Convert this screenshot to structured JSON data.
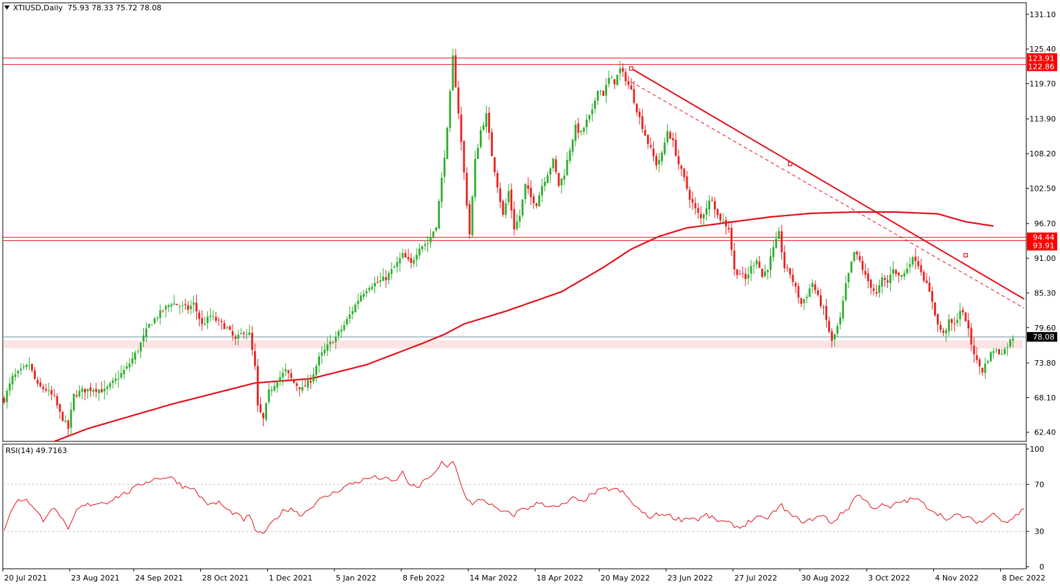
{
  "header": {
    "symbol": "XTIUSD,Daily",
    "ohlc": "75.93 78.33 75.72 78.08"
  },
  "rsi_header": {
    "label": "RSI(14) 49.7163"
  },
  "price_axis": {
    "ticks": [
      "131.10",
      "125.40",
      "119.70",
      "113.90",
      "108.20",
      "102.50",
      "96.70",
      "91.00",
      "85.30",
      "79.60",
      "73.80",
      "68.10",
      "62.40"
    ],
    "tick_values": [
      131.1,
      125.4,
      119.7,
      113.9,
      108.2,
      102.5,
      96.7,
      91.0,
      85.3,
      79.6,
      73.8,
      68.1,
      62.4
    ]
  },
  "rsi_axis": {
    "ticks": [
      "100",
      "70",
      "30",
      "0"
    ],
    "tick_values": [
      100,
      70,
      30,
      0
    ]
  },
  "price_labels": [
    {
      "text": "123.91",
      "value": 123.91,
      "bg": "#ff0000",
      "color": "#ffffff"
    },
    {
      "text": "122.86",
      "value": 122.86,
      "bg": "#ff0000",
      "color": "#ffffff"
    },
    {
      "text": "94.44",
      "value": 94.44,
      "bg": "#ff0000",
      "color": "#ffffff"
    },
    {
      "text": "93.91",
      "value": 93.91,
      "bg": "#ff0000",
      "color": "#ffffff"
    },
    {
      "text": "78.08",
      "value": 78.08,
      "bg": "#000000",
      "color": "#ffffff"
    }
  ],
  "time_axis": {
    "labels": [
      "20 Jul 2021",
      "23 Aug 2021",
      "24 Sep 2021",
      "28 Oct 2021",
      "1 Dec 2021",
      "5 Jan 2022",
      "8 Feb 2022",
      "14 Mar 2022",
      "18 Apr 2022",
      "20 May 2022",
      "23 Jun 2022",
      "27 Jul 2022",
      "30 Aug 2022",
      "3 Oct 2022",
      "4 Nov 2022",
      "8 Dec 2022"
    ],
    "bar_index": [
      0,
      24,
      47,
      71,
      95,
      119,
      143,
      167,
      191,
      214,
      238,
      262,
      286,
      310,
      334,
      358
    ]
  },
  "colors": {
    "bull": "#2eae2e",
    "bear": "#e8201e",
    "line": "#e2101a",
    "zone": "#fde4e4",
    "grid": "#c8c8c8",
    "axis": "#000000"
  },
  "chart_data": {
    "type": "candlestick",
    "symbol": "XTIUSD",
    "timeframe": "Daily",
    "ylim": [
      60.9,
      133.0
    ],
    "bars_visible": 367,
    "anchors": [
      [
        0,
        67.8
      ],
      [
        3,
        71.4
      ],
      [
        7,
        72.8
      ],
      [
        9,
        73.5
      ],
      [
        12,
        70.0
      ],
      [
        15,
        69.4
      ],
      [
        18,
        68.0
      ],
      [
        20,
        65.5
      ],
      [
        23,
        63.0
      ],
      [
        25,
        68.5
      ],
      [
        28,
        69.2
      ],
      [
        32,
        69.6
      ],
      [
        36,
        69.2
      ],
      [
        40,
        71.0
      ],
      [
        44,
        73.0
      ],
      [
        48,
        76.0
      ],
      [
        52,
        80.0
      ],
      [
        56,
        82.0
      ],
      [
        60,
        83.7
      ],
      [
        63,
        83.2
      ],
      [
        66,
        82.7
      ],
      [
        68,
        83.5
      ],
      [
        71,
        80.0
      ],
      [
        74,
        81.5
      ],
      [
        77,
        80.5
      ],
      [
        80,
        79.5
      ],
      [
        83,
        77.5
      ],
      [
        86,
        79.0
      ],
      [
        88,
        78.5
      ],
      [
        90,
        73.0
      ],
      [
        91,
        66.5
      ],
      [
        93,
        64.5
      ],
      [
        95,
        69.0
      ],
      [
        98,
        71.0
      ],
      [
        101,
        72.5
      ],
      [
        104,
        70.5
      ],
      [
        107,
        69.5
      ],
      [
        110,
        71.0
      ],
      [
        113,
        74.5
      ],
      [
        116,
        76.5
      ],
      [
        119,
        78.0
      ],
      [
        122,
        80.0
      ],
      [
        125,
        82.5
      ],
      [
        128,
        85.0
      ],
      [
        131,
        86.5
      ],
      [
        134,
        87.0
      ],
      [
        137,
        87.8
      ],
      [
        140,
        89.5
      ],
      [
        143,
        91.5
      ],
      [
        146,
        90.0
      ],
      [
        149,
        93.0
      ],
      [
        152,
        93.5
      ],
      [
        155,
        96.5
      ],
      [
        157,
        104.0
      ],
      [
        159,
        112.0
      ],
      [
        161,
        124.0
      ],
      [
        163,
        115.0
      ],
      [
        165,
        105.0
      ],
      [
        167,
        95.0
      ],
      [
        169,
        107.0
      ],
      [
        171,
        112.0
      ],
      [
        173,
        114.5
      ],
      [
        175,
        108.0
      ],
      [
        177,
        103.0
      ],
      [
        179,
        98.0
      ],
      [
        181,
        102.0
      ],
      [
        183,
        96.0
      ],
      [
        185,
        98.0
      ],
      [
        187,
        103.0
      ],
      [
        189,
        101.0
      ],
      [
        191,
        100.0
      ],
      [
        193,
        103.0
      ],
      [
        195,
        105.0
      ],
      [
        197,
        107.0
      ],
      [
        199,
        103.0
      ],
      [
        201,
        105.0
      ],
      [
        203,
        109.0
      ],
      [
        205,
        112.5
      ],
      [
        207,
        111.5
      ],
      [
        209,
        113.5
      ],
      [
        211,
        115.0
      ],
      [
        213,
        119.0
      ],
      [
        215,
        118.0
      ],
      [
        217,
        120.5
      ],
      [
        219,
        120.0
      ],
      [
        221,
        122.0
      ],
      [
        223,
        120.5
      ],
      [
        225,
        118.5
      ],
      [
        228,
        114.0
      ],
      [
        231,
        110.0
      ],
      [
        234,
        106.5
      ],
      [
        236,
        108.0
      ],
      [
        238,
        112.0
      ],
      [
        240,
        110.0
      ],
      [
        242,
        106.5
      ],
      [
        244,
        104.0
      ],
      [
        246,
        101.0
      ],
      [
        248,
        99.0
      ],
      [
        250,
        97.5
      ],
      [
        252,
        99.5
      ],
      [
        254,
        101.0
      ],
      [
        256,
        98.0
      ],
      [
        258,
        97.0
      ],
      [
        260,
        96.0
      ],
      [
        262,
        89.0
      ],
      [
        264,
        88.5
      ],
      [
        266,
        87.5
      ],
      [
        268,
        89.5
      ],
      [
        270,
        91.0
      ],
      [
        272,
        88.0
      ],
      [
        274,
        89.5
      ],
      [
        276,
        92.5
      ],
      [
        278,
        95.0
      ],
      [
        280,
        89.5
      ],
      [
        282,
        88.5
      ],
      [
        284,
        86.0
      ],
      [
        286,
        83.5
      ],
      [
        288,
        85.0
      ],
      [
        290,
        87.0
      ],
      [
        292,
        84.5
      ],
      [
        294,
        82.5
      ],
      [
        296,
        79.0
      ],
      [
        297,
        77.2
      ],
      [
        300,
        81.0
      ],
      [
        302,
        86.5
      ],
      [
        305,
        92.0
      ],
      [
        307,
        90.5
      ],
      [
        309,
        88.0
      ],
      [
        311,
        86.5
      ],
      [
        313,
        85.0
      ],
      [
        315,
        87.5
      ],
      [
        317,
        87.0
      ],
      [
        319,
        89.5
      ],
      [
        321,
        88.0
      ],
      [
        323,
        88.5
      ],
      [
        325,
        90.5
      ],
      [
        327,
        91.0
      ],
      [
        329,
        89.0
      ],
      [
        331,
        86.5
      ],
      [
        333,
        84.0
      ],
      [
        335,
        80.0
      ],
      [
        337,
        78.5
      ],
      [
        339,
        80.5
      ],
      [
        341,
        80.0
      ],
      [
        343,
        82.5
      ],
      [
        345,
        81.0
      ],
      [
        347,
        77.0
      ],
      [
        349,
        74.0
      ],
      [
        351,
        72.5
      ],
      [
        353,
        74.5
      ],
      [
        355,
        76.0
      ],
      [
        357,
        75.5
      ],
      [
        359,
        76.0
      ],
      [
        362,
        78.08
      ]
    ],
    "ma200": [
      [
        18,
        60.9
      ],
      [
        30,
        63.0
      ],
      [
        60,
        67.0
      ],
      [
        90,
        70.5
      ],
      [
        110,
        71.2
      ],
      [
        130,
        73.5
      ],
      [
        150,
        77.0
      ],
      [
        158,
        78.5
      ],
      [
        165,
        80.2
      ],
      [
        180,
        82.3
      ],
      [
        200,
        85.5
      ],
      [
        215,
        89.5
      ],
      [
        225,
        92.5
      ],
      [
        235,
        94.6
      ],
      [
        245,
        96.0
      ],
      [
        260,
        96.9
      ],
      [
        275,
        97.8
      ],
      [
        290,
        98.4
      ],
      [
        305,
        98.6
      ],
      [
        320,
        98.6
      ],
      [
        335,
        98.3
      ],
      [
        345,
        97.0
      ],
      [
        355,
        96.3
      ]
    ],
    "rsi": {
      "period": 14,
      "last": 49.7163,
      "anchors": [
        [
          0,
          32
        ],
        [
          4,
          55
        ],
        [
          8,
          58
        ],
        [
          11,
          48
        ],
        [
          14,
          40
        ],
        [
          17,
          50
        ],
        [
          20,
          44
        ],
        [
          23,
          30
        ],
        [
          26,
          48
        ],
        [
          29,
          52
        ],
        [
          33,
          54
        ],
        [
          37,
          55
        ],
        [
          41,
          60
        ],
        [
          45,
          64
        ],
        [
          49,
          70
        ],
        [
          53,
          74
        ],
        [
          57,
          76
        ],
        [
          61,
          75
        ],
        [
          64,
          68
        ],
        [
          67,
          68
        ],
        [
          71,
          58
        ],
        [
          74,
          52
        ],
        [
          77,
          55
        ],
        [
          80,
          48
        ],
        [
          83,
          45
        ],
        [
          86,
          40
        ],
        [
          88,
          43
        ],
        [
          90,
          32
        ],
        [
          92,
          28
        ],
        [
          94,
          30
        ],
        [
          97,
          40
        ],
        [
          100,
          47
        ],
        [
          103,
          50
        ],
        [
          106,
          44
        ],
        [
          109,
          48
        ],
        [
          112,
          55
        ],
        [
          116,
          60
        ],
        [
          120,
          65
        ],
        [
          124,
          70
        ],
        [
          128,
          73
        ],
        [
          132,
          76
        ],
        [
          136,
          75
        ],
        [
          140,
          72
        ],
        [
          143,
          80
        ],
        [
          146,
          68
        ],
        [
          149,
          68
        ],
        [
          152,
          76
        ],
        [
          155,
          80
        ],
        [
          157,
          88
        ],
        [
          159,
          84
        ],
        [
          161,
          90
        ],
        [
          163,
          78
        ],
        [
          165,
          62
        ],
        [
          168,
          52
        ],
        [
          171,
          58
        ],
        [
          174,
          54
        ],
        [
          177,
          48
        ],
        [
          180,
          46
        ],
        [
          183,
          44
        ],
        [
          186,
          50
        ],
        [
          189,
          50
        ],
        [
          192,
          55
        ],
        [
          195,
          52
        ],
        [
          198,
          50
        ],
        [
          201,
          53
        ],
        [
          204,
          58
        ],
        [
          207,
          55
        ],
        [
          210,
          60
        ],
        [
          213,
          64
        ],
        [
          216,
          66
        ],
        [
          219,
          66
        ],
        [
          222,
          63
        ],
        [
          225,
          55
        ],
        [
          228,
          48
        ],
        [
          231,
          42
        ],
        [
          234,
          44
        ],
        [
          237,
          45
        ],
        [
          240,
          42
        ],
        [
          243,
          40
        ],
        [
          246,
          42
        ],
        [
          249,
          40
        ],
        [
          252,
          44
        ],
        [
          255,
          40
        ],
        [
          258,
          38
        ],
        [
          261,
          36
        ],
        [
          264,
          33
        ],
        [
          267,
          38
        ],
        [
          270,
          42
        ],
        [
          273,
          40
        ],
        [
          276,
          46
        ],
        [
          279,
          52
        ],
        [
          282,
          44
        ],
        [
          285,
          40
        ],
        [
          288,
          38
        ],
        [
          291,
          42
        ],
        [
          294,
          43
        ],
        [
          297,
          37
        ],
        [
          300,
          44
        ],
        [
          303,
          50
        ],
        [
          306,
          62
        ],
        [
          309,
          56
        ],
        [
          312,
          50
        ],
        [
          315,
          52
        ],
        [
          318,
          50
        ],
        [
          321,
          55
        ],
        [
          324,
          56
        ],
        [
          327,
          58
        ],
        [
          330,
          53
        ],
        [
          333,
          48
        ],
        [
          336,
          44
        ],
        [
          339,
          40
        ],
        [
          342,
          44
        ],
        [
          345,
          42
        ],
        [
          348,
          39
        ],
        [
          351,
          38
        ],
        [
          354,
          44
        ],
        [
          356,
          45
        ],
        [
          358,
          40
        ],
        [
          360,
          38
        ],
        [
          362,
          42
        ],
        [
          364,
          45
        ],
        [
          366,
          50
        ]
      ]
    },
    "horizontal_lines": [
      123.91,
      122.86,
      94.44,
      93.91,
      78.08
    ],
    "support_zone": [
      76.2,
      77.5
    ],
    "trendline": {
      "from": [
        225,
        122.2
      ],
      "to": [
        366,
        84.3
      ],
      "markers": [
        [
          225,
          122.2
        ],
        [
          282,
          106.5
        ],
        [
          345,
          91.5
        ]
      ]
    },
    "parallel_dashed": {
      "from": [
        225,
        120.0
      ],
      "to": [
        366,
        82.8
      ]
    }
  }
}
